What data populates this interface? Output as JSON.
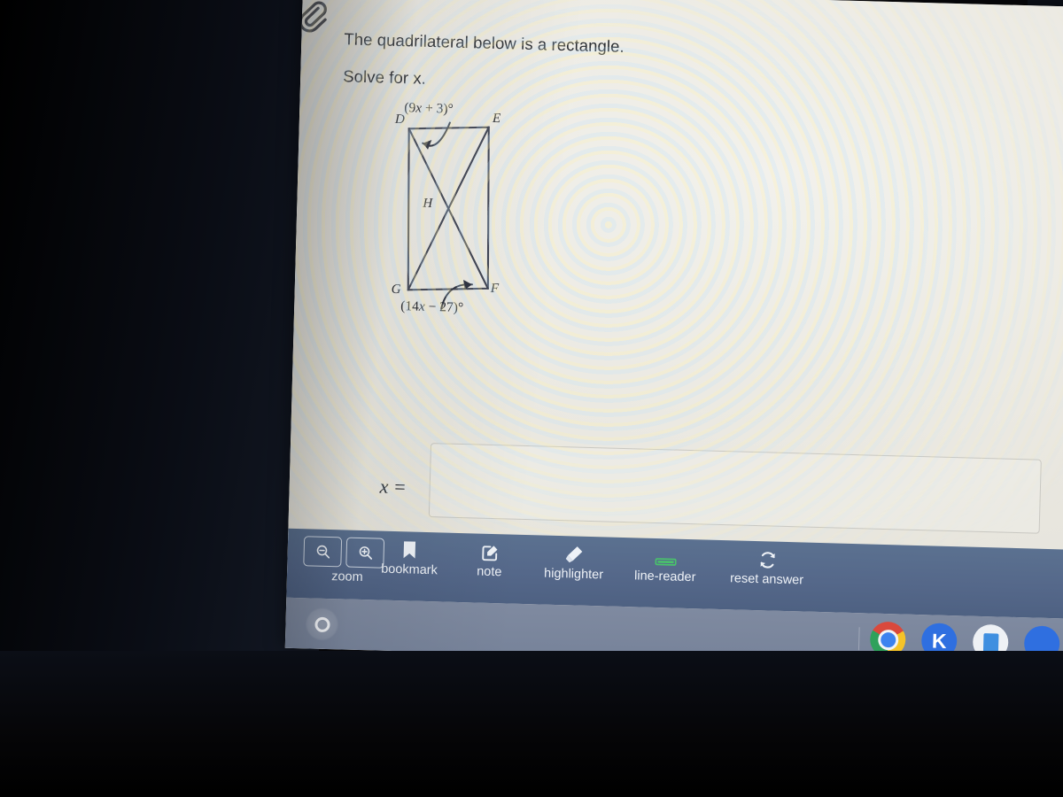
{
  "question": {
    "line1": "The quadrilateral below is a rectangle.",
    "line2": "Solve for x."
  },
  "figure": {
    "shape": "rectangle",
    "vertices": {
      "top_left": "D",
      "top_right": "E",
      "bottom_right": "F",
      "bottom_left": "G",
      "diagonal_intersection": "H"
    },
    "angle_top_label": "(9x + 3)°",
    "angle_bottom_label": "(14x − 27)°",
    "angle_top_parts": {
      "open": "(9",
      "var": "x",
      "rest": " + 3)°"
    },
    "angle_bottom_parts": {
      "open": "(14",
      "var": "x",
      "rest": " − 27)°"
    },
    "stroke_color": "#3c4150"
  },
  "answer": {
    "label": "x =",
    "value": "",
    "placeholder": ""
  },
  "toolbar": {
    "zoom_label": "zoom",
    "zoom_out_icon": "magnifier-minus-icon",
    "zoom_in_icon": "magnifier-plus-icon",
    "tools": [
      {
        "label": "bookmark",
        "icon": "bookmark-icon"
      },
      {
        "label": "note",
        "icon": "note-pencil-icon"
      },
      {
        "label": "highlighter",
        "icon": "highlighter-icon"
      },
      {
        "label": "line-reader",
        "icon": "line-reader-icon"
      },
      {
        "label": "reset answer",
        "icon": "refresh-icon"
      }
    ],
    "background_color": "#55688a",
    "text_color": "#eef2f7"
  },
  "shelf": {
    "launcher_icon": "launcher-circle-icon",
    "apps": [
      {
        "name": "chrome-app-icon",
        "label": ""
      },
      {
        "name": "khan-academy-app-icon",
        "label": "K"
      },
      {
        "name": "docs-app-icon",
        "label": ""
      },
      {
        "name": "edge-app-icon",
        "label": ""
      }
    ],
    "background_color": "#77839a"
  },
  "page": {
    "attachment_icon": "paperclip-icon",
    "background_color": "#eceae3"
  }
}
